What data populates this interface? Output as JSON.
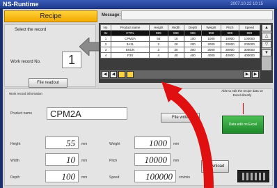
{
  "window": {
    "title": "NS-Runtime",
    "clock": "2007.10.22  10:15"
  },
  "header": {
    "tab_label": "Recipe",
    "message_label": "Message:"
  },
  "select": {
    "title": "Select the record",
    "work_record_label": "Work record No.",
    "work_record_value": "1",
    "file_readout_label": "File readout"
  },
  "table": {
    "headers": [
      "No.",
      "Product name",
      "Height",
      "Width",
      "Depth",
      "Weight",
      "Pitch",
      "Speed"
    ],
    "rows": [
      [
        "0x",
        "CTRL",
        "999",
        "999",
        "999",
        "999",
        "999",
        "999"
      ],
      [
        "1",
        "CPM2A",
        "55",
        "10",
        "100",
        "1000",
        "10000",
        "100000"
      ],
      [
        "2",
        "3A3L",
        "2",
        "20",
        "200",
        "2000",
        "20000",
        "200000"
      ],
      [
        "3",
        "E5CN",
        "3",
        "30",
        "300",
        "3000",
        "30000",
        "300000"
      ],
      [
        "4",
        "F3S",
        "4",
        "40",
        "400",
        "4000",
        "40000",
        "400000"
      ]
    ]
  },
  "info": {
    "title": "Work record information",
    "edit_note": "Able to edit the recipe data on Excel directly",
    "edit_button": "Data edit on Excel",
    "product_name_label": "Product name",
    "product_name_value": "CPM2A",
    "file_write_label": "File write",
    "download_label": "Download",
    "fields": {
      "height_label": "Height",
      "height_value": "55",
      "height_unit": "mm",
      "width_label": "Width",
      "width_value": "10",
      "width_unit": "mm",
      "depth_label": "Depth",
      "depth_value": "100",
      "depth_unit": "mm",
      "weight_label": "Weight",
      "weight_value": "1000",
      "weight_unit": "mm",
      "pitch_label": "Pitch",
      "pitch_value": "10000",
      "pitch_unit": "mm",
      "speed_label": "Speed",
      "speed_value": "100000",
      "speed_unit": "cm/min"
    }
  },
  "colors": {
    "accent_tab": "#f3a800",
    "excel_button": "#1e8a2a",
    "arrow": "#e01010",
    "titlebar": "#1c3a8c"
  }
}
